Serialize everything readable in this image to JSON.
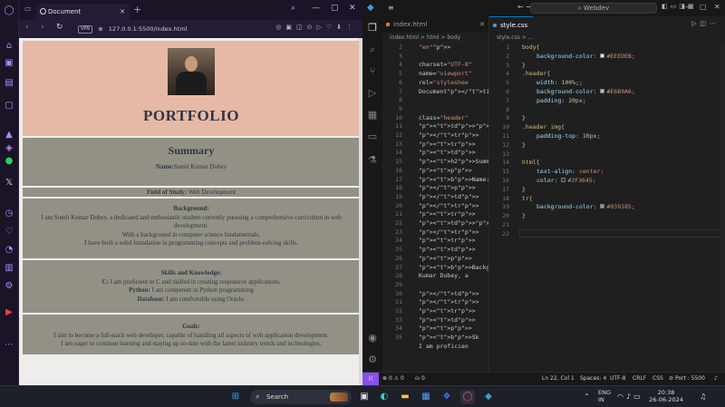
{
  "browser": {
    "tab_title": "Document",
    "url": "127.0.0.1:5500/index.html",
    "vpn_label": "VPN"
  },
  "page": {
    "title": "PORTFOLIO",
    "summary_heading": "Summary",
    "name_label": "Name:",
    "name_value": "Sumit Kumar Dubey",
    "field_label": "Field of Study:",
    "field_value": "Web Development",
    "background_label": "Background:",
    "background_lines": [
      "I am Sumit Kumar Dubey, a dedicated and enthusiastic student currently pursuing a comprehensive curriculum in web development.",
      "With a background in computer science fundamentals,",
      "I have built a solid foundation in programming concepts and problem-solving skills."
    ],
    "skills_label": "Skills and Knowledge:",
    "skills": [
      {
        "label": "C:",
        "text": "I am proficient in C and skilled in creating responsive applications."
      },
      {
        "label": "Python:",
        "text": "I am competent in Python programming"
      },
      {
        "label": "Database:",
        "text": "I am comfortable using Oracle."
      }
    ],
    "goals_label": "Goals:",
    "goals_lines": [
      "I aim to become a full-stack web developer, capable of handling all aspects of web application development.",
      "I am eager to continue learning and staying up-to-date with the latest industry trends and technologies."
    ]
  },
  "vscode": {
    "search_placeholder": "Webdev",
    "left_tab": "index.html",
    "left_breadcrumb": "index.html > html > body",
    "right_tab": "style.css",
    "right_breadcrumb": "style.css > ...",
    "html_lines": [
      {
        "n": "2",
        "code": "\"en\">"
      },
      {
        "n": "3",
        "code": ""
      },
      {
        "n": "4",
        "code": "charset=\"UTF-8\""
      },
      {
        "n": "5",
        "code": "name=\"viewport\""
      },
      {
        "n": "6",
        "code": "rel=\"styleshee"
      },
      {
        "n": "7",
        "code": "Document</tit"
      },
      {
        "n": "8",
        "code": ""
      },
      {
        "n": "9",
        "code": ""
      },
      {
        "n": "10",
        "code": "class=\"header\""
      },
      {
        "n": "11",
        "code": "<td><img src"
      },
      {
        "n": "12",
        "code": "</tr>"
      },
      {
        "n": "13",
        "code": "<tr>"
      },
      {
        "n": "14",
        "code": "<td>"
      },
      {
        "n": "15",
        "code": "<h2>Summary</"
      },
      {
        "n": "16",
        "code": "<p>"
      },
      {
        "n": "17",
        "code": "<b>Name:</"
      },
      {
        "n": "18",
        "code": "</p>"
      },
      {
        "n": "19",
        "code": "</td>"
      },
      {
        "n": "20",
        "code": "</tr>"
      },
      {
        "n": "21",
        "code": "<tr>"
      },
      {
        "n": "22",
        "code": "<td><b>Field"
      },
      {
        "n": "23",
        "code": "</tr>"
      },
      {
        "n": "24",
        "code": "<tr>"
      },
      {
        "n": "25",
        "code": "<td>"
      },
      {
        "n": "26",
        "code": "<p>"
      },
      {
        "n": "27",
        "code": "<b>Backgr"
      },
      {
        "n": "28",
        "code": "Kumar Dubey, a"
      },
      {
        "n": "29",
        "code": ""
      },
      {
        "n": "30",
        "code": "</td>"
      },
      {
        "n": "31",
        "code": "</tr>"
      },
      {
        "n": "32",
        "code": "<tr>"
      },
      {
        "n": "33",
        "code": "<td>"
      },
      {
        "n": "34",
        "code": "<p>"
      },
      {
        "n": "35",
        "code": "<b>Sk"
      },
      {
        "n": "",
        "code": "I am proficien"
      }
    ],
    "css_lines": [
      {
        "n": "1",
        "code": "body{",
        "k": "sel"
      },
      {
        "n": "2",
        "code": "background-color:",
        "v": "#EEEDEB;",
        "sw": "#EEEDEB"
      },
      {
        "n": "3",
        "code": "}",
        "k": "p"
      },
      {
        "n": "4",
        "code": ".header{",
        "k": "sel"
      },
      {
        "n": "5",
        "code": "width:",
        "v": "100%;;",
        "k": "num"
      },
      {
        "n": "6",
        "code": "background-color:",
        "v": "#E6B9A6;",
        "sw": "#E6B9A6"
      },
      {
        "n": "7",
        "code": "padding:",
        "v": "20px;",
        "k": "num"
      },
      {
        "n": "8",
        "code": ""
      },
      {
        "n": "9",
        "code": "}",
        "k": "p"
      },
      {
        "n": "10",
        "code": ".header img{",
        "k": "sel"
      },
      {
        "n": "11",
        "code": "padding-top:",
        "v": "10px;",
        "k": "num"
      },
      {
        "n": "12",
        "code": "}",
        "k": "p"
      },
      {
        "n": "13",
        "code": ""
      },
      {
        "n": "14",
        "code": "html{",
        "k": "sel"
      },
      {
        "n": "15",
        "code": "text-align:",
        "v": "center;"
      },
      {
        "n": "16",
        "code": "color:",
        "v": "#2F3645;",
        "sw": "#2F3645"
      },
      {
        "n": "17",
        "code": "}",
        "k": "p"
      },
      {
        "n": "18",
        "code": "tr{",
        "k": "sel"
      },
      {
        "n": "19",
        "code": "background-color:",
        "v": "#939185;",
        "sw": "#939185"
      },
      {
        "n": "20",
        "code": "}",
        "k": "p"
      },
      {
        "n": "21",
        "code": ""
      },
      {
        "n": "22",
        "code": ""
      }
    ],
    "status": {
      "errors": "0",
      "warnings": "0",
      "ports": "0",
      "position": "Ln 22, Col 1",
      "spaces": "Spaces: 4",
      "encoding": "UTF-8",
      "eol": "CRLF",
      "language": "CSS",
      "port": "Port : 5500"
    }
  },
  "taskbar": {
    "search_label": "Search",
    "lang": "ENG",
    "region": "IN",
    "time": "20:38",
    "date": "26-06-2024"
  },
  "colors": {
    "body_bg": "#EEEDEB",
    "header_bg": "#E6B9A6",
    "text": "#2F3645",
    "row_bg": "#939185",
    "opera_accent": "#b487ff",
    "vscode_accent": "#8a4ff1"
  }
}
